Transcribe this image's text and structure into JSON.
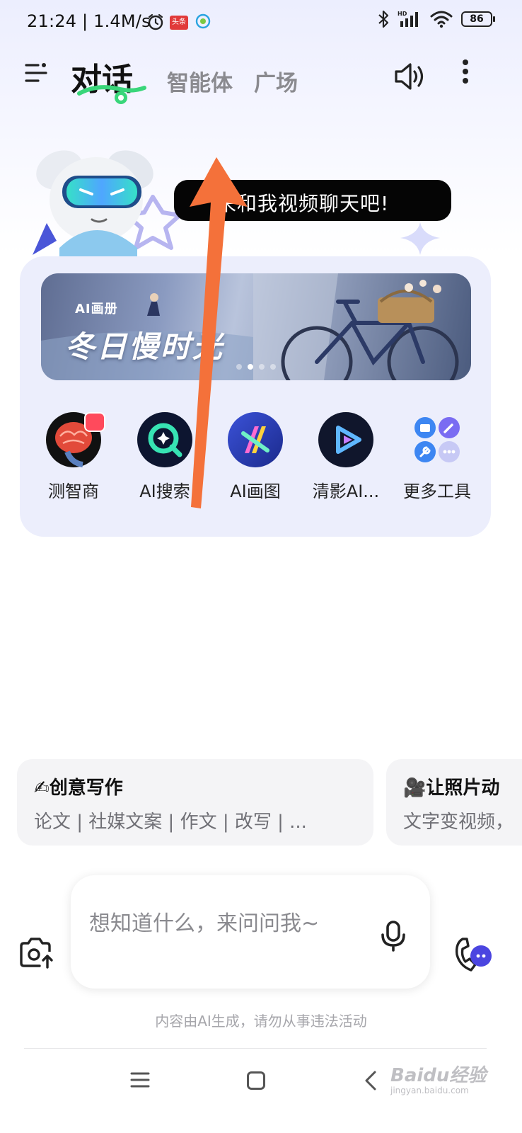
{
  "status_bar": {
    "time": "21:24 | 1.4M/s",
    "toutiao_badge": "头条",
    "battery": "86"
  },
  "header": {
    "tabs": [
      {
        "label": "对话",
        "active": true
      },
      {
        "label": "智能体",
        "active": false
      },
      {
        "label": "广场",
        "active": false
      }
    ],
    "icons": [
      "menu-icon",
      "speaker-icon",
      "more-icon"
    ]
  },
  "hero": {
    "bubble_text": "来和我视频聊天吧!"
  },
  "banner": {
    "tag": "AI画册",
    "title": "冬日慢时光",
    "slide_count": 4,
    "active_slide": 2
  },
  "tools": [
    {
      "label": "测智商",
      "icon": "brain-icon",
      "hot": true
    },
    {
      "label": "AI搜索",
      "icon": "search-q-icon",
      "hot": false
    },
    {
      "label": "AI画图",
      "icon": "ai-draw-icon",
      "hot": false
    },
    {
      "label": "清影AI...",
      "icon": "video-play-icon",
      "hot": false
    },
    {
      "label": "更多工具",
      "icon": "more-tools-icon",
      "hot": false
    }
  ],
  "suggestions": [
    {
      "emoji": "✍",
      "title": "创意写作",
      "subtitle": "论文 | 社媒文案 | 作文 | 改写 | ..."
    },
    {
      "emoji": "🎥",
      "title": "让照片动",
      "subtitle": "文字变视频，"
    }
  ],
  "input": {
    "placeholder": "想知道什么，来问问我~"
  },
  "disclaimer": "内容由AI生成，请勿从事违法活动",
  "watermark": {
    "main": "Baidu经验",
    "sub": "jingyan.baidu.com"
  },
  "colors": {
    "accent_green": "#39d67a",
    "card_bg": "#eceefc",
    "arrow": "#f4713a",
    "bubble_bg": "#050505"
  }
}
